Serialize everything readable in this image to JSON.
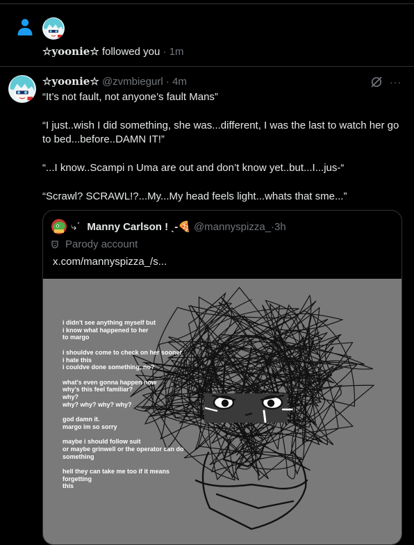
{
  "notification": {
    "actor_name": "☆yoonie☆",
    "action": " followed you",
    "separator": " · ",
    "time": "1m"
  },
  "post": {
    "display_name": "☆yoonie☆",
    "handle": "@zvmbiegurl",
    "separator": " · ",
    "time": "4m",
    "paragraphs": [
      "“It’s not fault, not anyone’s fault Mans”",
      "“I just..wish I did something, she was...different, I was the last to watch her go to bed...before..DAMN IT!”",
      "“...I know..Scampi n Uma are out and don’t know yet..but...I...jus-“",
      "“Scrawl? SCRAWL!?...My...My head feels light...whats that sme...”"
    ],
    "more_label": "···"
  },
  "quote": {
    "avatar_suffix": "⤷ˊ",
    "display_name": "Manny Carlson ! ˎ-🍕",
    "handle": "@mannyspizza_",
    "separator": " · ",
    "time": "3h",
    "parody_label": "Parody account",
    "link": "x.com/mannyspizza_/s..."
  },
  "image_text": [
    "i didn't see anything myself but",
    "i know what happened to her",
    "to margo",
    "",
    "i shouldve come to check on her sooner",
    "i hate this",
    "i couldve done something, no?",
    "",
    "what's even gonna happen now",
    "why's this feel familiar?",
    "why?",
    "why? why? why? why?",
    "",
    "god damn it.",
    "margo im so sorry",
    "",
    "maybe i should follow suit",
    "or maybe grinwell or the operator can do",
    "something",
    "",
    "hell they can take me too if it means",
    "forgetting",
    "this"
  ],
  "colors": {
    "background": "#000000",
    "text": "#e7e9ea",
    "muted": "#71767b",
    "divider": "#2f3336",
    "accent": "#1d9bf0",
    "image_bg": "#7a7a7a"
  }
}
